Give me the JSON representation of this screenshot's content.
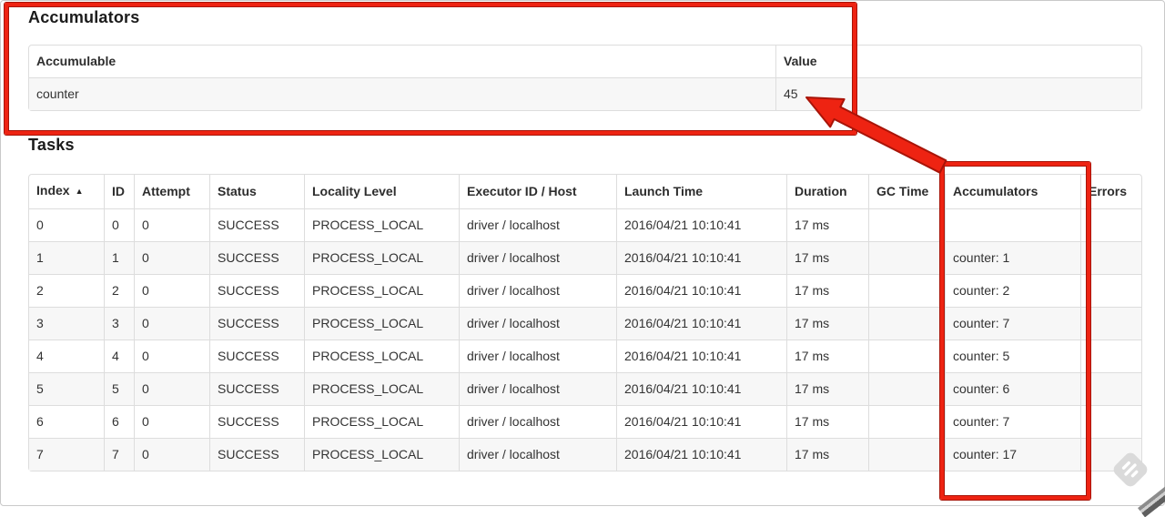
{
  "annotation": {
    "red": "#ee2312",
    "red_dark": "#a81408",
    "watermark_gray": "#dadada"
  },
  "accumulators": {
    "title": "Accumulators",
    "headers": [
      "Accumulable",
      "Value"
    ],
    "rows": [
      [
        "counter",
        "45"
      ]
    ]
  },
  "tasks": {
    "title": "Tasks",
    "sort_arrow": "▲",
    "headers": [
      "Index",
      "ID",
      "Attempt",
      "Status",
      "Locality Level",
      "Executor ID / Host",
      "Launch Time",
      "Duration",
      "GC Time",
      "Accumulators",
      "Errors"
    ],
    "rows": [
      [
        "0",
        "0",
        "0",
        "SUCCESS",
        "PROCESS_LOCAL",
        "driver / localhost",
        "2016/04/21 10:10:41",
        "17 ms",
        "",
        "",
        ""
      ],
      [
        "1",
        "1",
        "0",
        "SUCCESS",
        "PROCESS_LOCAL",
        "driver / localhost",
        "2016/04/21 10:10:41",
        "17 ms",
        "",
        "counter: 1",
        ""
      ],
      [
        "2",
        "2",
        "0",
        "SUCCESS",
        "PROCESS_LOCAL",
        "driver / localhost",
        "2016/04/21 10:10:41",
        "17 ms",
        "",
        "counter: 2",
        ""
      ],
      [
        "3",
        "3",
        "0",
        "SUCCESS",
        "PROCESS_LOCAL",
        "driver / localhost",
        "2016/04/21 10:10:41",
        "17 ms",
        "",
        "counter: 7",
        ""
      ],
      [
        "4",
        "4",
        "0",
        "SUCCESS",
        "PROCESS_LOCAL",
        "driver / localhost",
        "2016/04/21 10:10:41",
        "17 ms",
        "",
        "counter: 5",
        ""
      ],
      [
        "5",
        "5",
        "0",
        "SUCCESS",
        "PROCESS_LOCAL",
        "driver / localhost",
        "2016/04/21 10:10:41",
        "17 ms",
        "",
        "counter: 6",
        ""
      ],
      [
        "6",
        "6",
        "0",
        "SUCCESS",
        "PROCESS_LOCAL",
        "driver / localhost",
        "2016/04/21 10:10:41",
        "17 ms",
        "",
        "counter: 7",
        ""
      ],
      [
        "7",
        "7",
        "0",
        "SUCCESS",
        "PROCESS_LOCAL",
        "driver / localhost",
        "2016/04/21 10:10:41",
        "17 ms",
        "",
        "counter: 17",
        ""
      ]
    ]
  }
}
